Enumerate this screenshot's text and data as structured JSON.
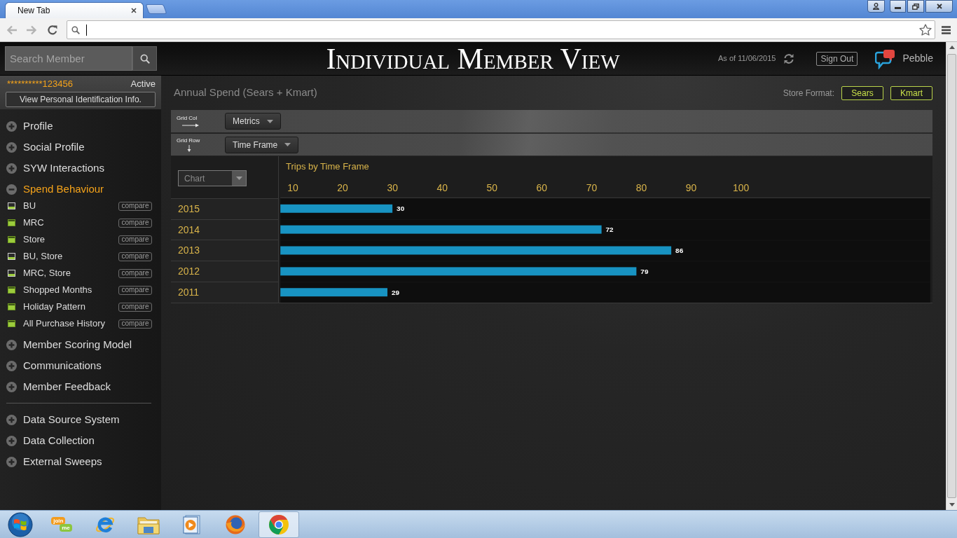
{
  "browser": {
    "tabs": [
      {
        "title": "New Tab",
        "selected": true
      }
    ]
  },
  "header": {
    "search": {
      "placeholder": "Search Member"
    },
    "title": "Individual Member View",
    "as_of": "As of 11/06/2015",
    "sign_out": "Sign Out",
    "brand": "Pebble"
  },
  "member": {
    "masked_id": "**********123456",
    "status": "Active",
    "details_button": "View Personal Identification Info."
  },
  "menu_groups": [
    {
      "items": [
        {
          "label": "Profile",
          "expanded": false
        },
        {
          "label": "Social Profile",
          "expanded": false
        },
        {
          "label": "SYW Interactions",
          "expanded": false
        },
        {
          "label": "Spend Behaviour",
          "expanded": true,
          "children": [
            {
              "label": "BU",
              "filled": false,
              "button": "compare"
            },
            {
              "label": "MRC",
              "filled": true,
              "button": "compare"
            },
            {
              "label": "Store",
              "filled": true,
              "button": "compare"
            },
            {
              "label": "BU, Store",
              "filled": false,
              "button": "compare"
            },
            {
              "label": "MRC, Store",
              "filled": false,
              "button": "compare"
            },
            {
              "label": "Shopped Months",
              "filled": true,
              "button": "compare"
            },
            {
              "label": "Holiday Pattern",
              "filled": true,
              "button": "compare"
            },
            {
              "label": "All Purchase History",
              "filled": true,
              "button": "compare"
            }
          ]
        },
        {
          "label": "Member Scoring Model",
          "expanded": false
        },
        {
          "label": "Communications",
          "expanded": false
        },
        {
          "label": "Member Feedback",
          "expanded": false
        }
      ]
    },
    {
      "items": [
        {
          "label": "Data Source System",
          "expanded": false
        },
        {
          "label": "Data Collection",
          "expanded": false
        },
        {
          "label": "External Sweeps",
          "expanded": false
        }
      ]
    }
  ],
  "panel": {
    "title": "Annual Spend (Sears + Kmart)",
    "store_format_label": "Store Format:",
    "store_formats": [
      {
        "label": "Sears",
        "selected": true
      },
      {
        "label": "Kmart",
        "selected": true
      }
    ],
    "grid_col": {
      "label": "Grid Col",
      "value": "Metrics"
    },
    "grid_row": {
      "label": "Grid Row",
      "value": "Time Frame"
    },
    "view_select": "Chart",
    "chart_data": {
      "type": "bar",
      "orientation": "horizontal",
      "title": "Trips by Time Frame",
      "categories": [
        "2015",
        "2014",
        "2013",
        "2012",
        "2011"
      ],
      "values": [
        30,
        72,
        86,
        79,
        29
      ],
      "xlim": [
        7.5,
        138
      ],
      "xticks": [
        10,
        20,
        30,
        40,
        50,
        60,
        70,
        80,
        90,
        100
      ],
      "data_labels": true
    }
  },
  "taskbar": {
    "items": [
      {
        "kind": "joinme",
        "selected": false,
        "texts": [
          "join",
          "me"
        ]
      },
      {
        "kind": "ie",
        "selected": false
      },
      {
        "kind": "folder",
        "selected": false
      },
      {
        "kind": "player",
        "selected": false
      },
      {
        "kind": "firefox",
        "selected": false
      },
      {
        "kind": "chrome",
        "selected": true
      }
    ]
  }
}
